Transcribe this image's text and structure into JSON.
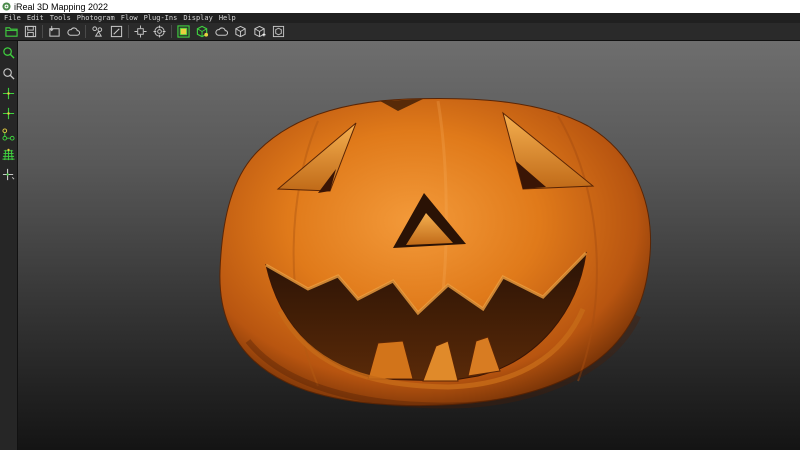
{
  "window": {
    "title": "iReal 3D Mapping 2022"
  },
  "menu": [
    {
      "label": "File"
    },
    {
      "label": "Edit"
    },
    {
      "label": "Tools"
    },
    {
      "label": "Photogram"
    },
    {
      "label": "Flow"
    },
    {
      "label": "Plug-Ins"
    },
    {
      "label": "Display"
    },
    {
      "label": "Help"
    }
  ],
  "toolbar": {
    "icons": [
      "open-folder-icon",
      "save-icon",
      "import-icon",
      "cloud-icon",
      "paint-icon",
      "edit-box-icon",
      "move-icon",
      "target-icon",
      "align-icon",
      "merge-icon",
      "cloud-mesh-icon",
      "cube-icon",
      "cube-plus-icon",
      "cube-export-icon"
    ]
  },
  "sidebar": {
    "icons": [
      "select-icon",
      "zoom-icon",
      "crosshair-icon",
      "crosshair-alt-icon",
      "nodes-icon",
      "grid-icon",
      "axis-icon"
    ]
  },
  "colors": {
    "accent_green": "#3fd23f",
    "icon_gray": "#c8c8c8",
    "pumpkin_orange": "#e07a1a",
    "viewport_top": "#6e6e6e",
    "viewport_bottom": "#141414"
  },
  "viewport": {
    "object": "3D scanned jack-o'-lantern pumpkin"
  }
}
